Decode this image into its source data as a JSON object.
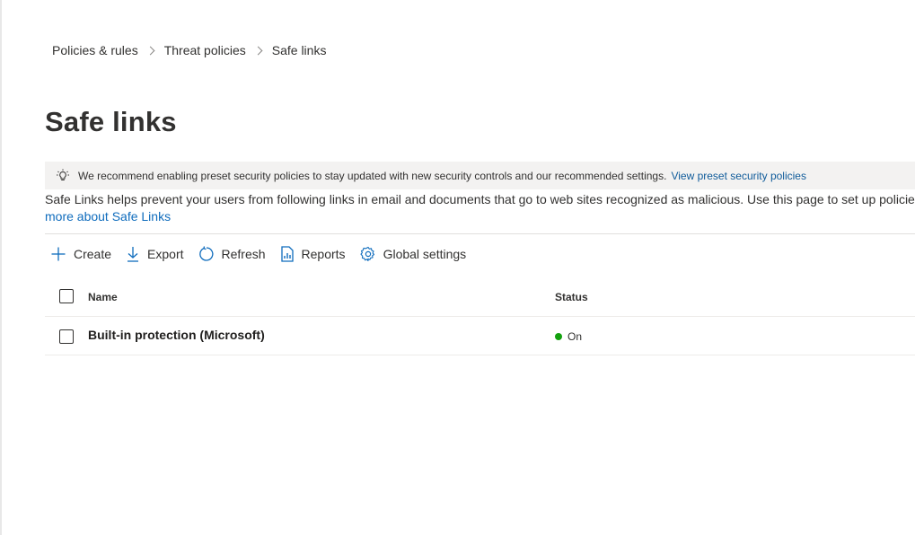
{
  "breadcrumb": [
    "Policies & rules",
    "Threat policies",
    "Safe links"
  ],
  "page": {
    "title": "Safe links"
  },
  "banner": {
    "text": "We recommend enabling preset security policies to stay updated with new security controls and our recommended settings.",
    "link": "View preset security policies"
  },
  "description": {
    "text": "Safe Links helps prevent your users from following links in email and documents that go to web sites recognized as malicious. Use this page to set up policies",
    "link": "more about Safe Links"
  },
  "commands": {
    "create": "Create",
    "export": "Export",
    "refresh": "Refresh",
    "reports": "Reports",
    "global_settings": "Global settings"
  },
  "table": {
    "columns": {
      "name": "Name",
      "status": "Status"
    },
    "rows": [
      {
        "name": "Built-in protection (Microsoft)",
        "status": "On"
      }
    ]
  },
  "colors": {
    "accent": "#0f6cbd",
    "status_on": "#13a10e",
    "banner_bg": "#f3f2f1"
  }
}
